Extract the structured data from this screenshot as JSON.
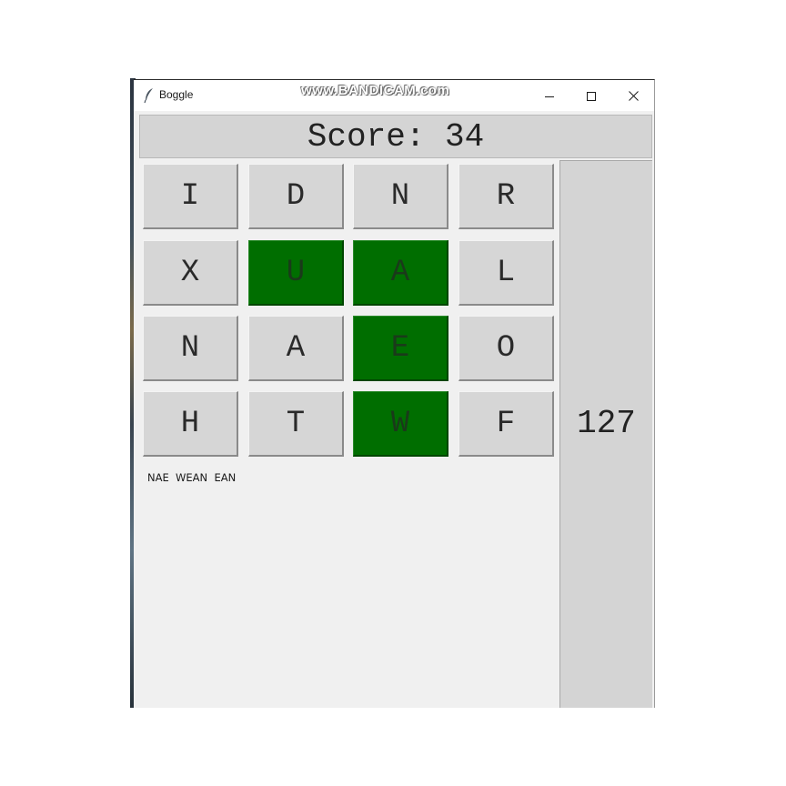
{
  "window": {
    "title": "Boggle",
    "watermark": "www.BANDICAM.com"
  },
  "score": {
    "text": "Score: 34"
  },
  "board": {
    "rows": [
      [
        {
          "letter": "I",
          "selected": false
        },
        {
          "letter": "D",
          "selected": false
        },
        {
          "letter": "N",
          "selected": false
        },
        {
          "letter": "R",
          "selected": false
        }
      ],
      [
        {
          "letter": "X",
          "selected": false
        },
        {
          "letter": "U",
          "selected": true
        },
        {
          "letter": "A",
          "selected": true
        },
        {
          "letter": "L",
          "selected": false
        }
      ],
      [
        {
          "letter": "N",
          "selected": false
        },
        {
          "letter": "A",
          "selected": false
        },
        {
          "letter": "E",
          "selected": true
        },
        {
          "letter": "O",
          "selected": false
        }
      ],
      [
        {
          "letter": "H",
          "selected": false
        },
        {
          "letter": "T",
          "selected": false
        },
        {
          "letter": "W",
          "selected": true
        },
        {
          "letter": "F",
          "selected": false
        }
      ]
    ],
    "selected_color": "#006e00",
    "tile_color": "#d6d6d6"
  },
  "timer": {
    "value": "127"
  },
  "found_words": {
    "text": "NAE  WEAN  EAN"
  },
  "icons": {
    "app": "feather-icon",
    "minimize": "minimize-icon",
    "maximize": "maximize-icon",
    "close": "close-icon"
  }
}
